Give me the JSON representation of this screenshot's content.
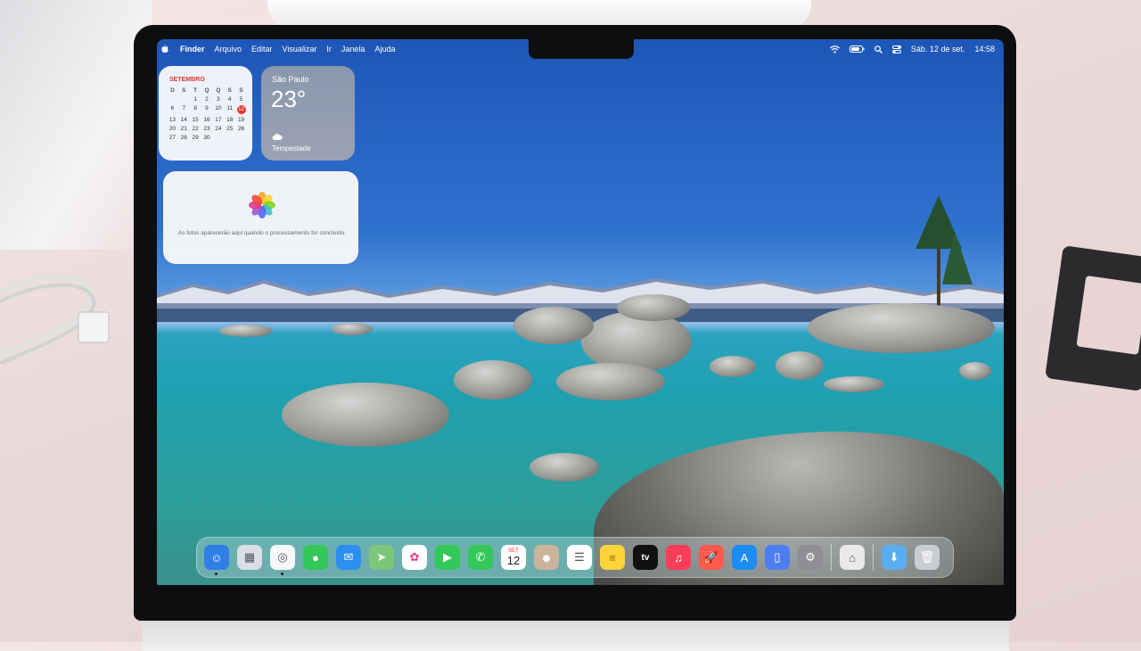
{
  "menubar": {
    "app_name": "Finder",
    "menus": [
      "Arquivo",
      "Editar",
      "Visualizar",
      "Ir",
      "Janela",
      "Ajuda"
    ],
    "datetime": "Sáb. 12 de set.",
    "time": "14:58"
  },
  "calendar_widget": {
    "month": "SETEMBRO",
    "weekdays": [
      "D",
      "S",
      "T",
      "Q",
      "Q",
      "S",
      "S"
    ],
    "days": [
      "",
      "",
      "1",
      "2",
      "3",
      "4",
      "5",
      "6",
      "7",
      "8",
      "9",
      "10",
      "11",
      "12",
      "13",
      "14",
      "15",
      "16",
      "17",
      "18",
      "19",
      "20",
      "21",
      "22",
      "23",
      "24",
      "25",
      "26",
      "27",
      "28",
      "29",
      "30",
      "",
      "",
      ""
    ],
    "today": "12"
  },
  "weather_widget": {
    "city": "São Paulo",
    "temperature": "23°",
    "condition": "Tempestade"
  },
  "photos_widget": {
    "message": "As fotos aparecerão aqui quando o processamento for concluído."
  },
  "dock": {
    "apps": [
      {
        "name": "finder",
        "color": "#2f7fe6",
        "glyph": "☺",
        "running": true
      },
      {
        "name": "launchpad",
        "color": "#d9dde6",
        "glyph": "▦",
        "running": false
      },
      {
        "name": "safari",
        "color": "#f5f7fa",
        "glyph": "◎",
        "running": true
      },
      {
        "name": "messages",
        "color": "#34c759",
        "glyph": "●",
        "running": false
      },
      {
        "name": "mail",
        "color": "#2c8ef0",
        "glyph": "✉",
        "running": false
      },
      {
        "name": "maps",
        "color": "#7cc67a",
        "glyph": "➤",
        "running": false
      },
      {
        "name": "photos",
        "color": "#ffffff",
        "glyph": "✿",
        "running": false
      },
      {
        "name": "facetime",
        "color": "#34c759",
        "glyph": "▶",
        "running": false
      },
      {
        "name": "phone",
        "color": "#34c759",
        "glyph": "✆",
        "running": false
      },
      {
        "name": "calendar",
        "color": "#ffffff",
        "glyph": "",
        "running": false
      },
      {
        "name": "contacts",
        "color": "#c9b39a",
        "glyph": "☻",
        "running": false
      },
      {
        "name": "reminders",
        "color": "#ffffff",
        "glyph": "☰",
        "running": false
      },
      {
        "name": "notes",
        "color": "#ffd43b",
        "glyph": "≡",
        "running": false
      },
      {
        "name": "tv",
        "color": "#111111",
        "glyph": "tv",
        "running": false
      },
      {
        "name": "music",
        "color": "#fc3d5a",
        "glyph": "♫",
        "running": false
      },
      {
        "name": "rocket",
        "color": "#ff5a4e",
        "glyph": "🚀",
        "running": false
      },
      {
        "name": "app-store",
        "color": "#1b8cf2",
        "glyph": "A",
        "running": false
      },
      {
        "name": "iphone-mirroring",
        "color": "#4d7ef0",
        "glyph": "▯",
        "running": false
      },
      {
        "name": "system-settings",
        "color": "#8e8e93",
        "glyph": "⚙",
        "running": false
      }
    ],
    "calendar_app": {
      "month": "SET",
      "day": "12"
    },
    "tv_label": "tv",
    "trailing": [
      {
        "name": "archive-utility",
        "color": "#e9e9ea",
        "glyph": "⌂"
      },
      {
        "name": "downloads-folder",
        "color": "#5aaef0",
        "glyph": "⬇"
      },
      {
        "name": "trash",
        "color": "#c9ccd1",
        "glyph": "🗑"
      }
    ]
  }
}
